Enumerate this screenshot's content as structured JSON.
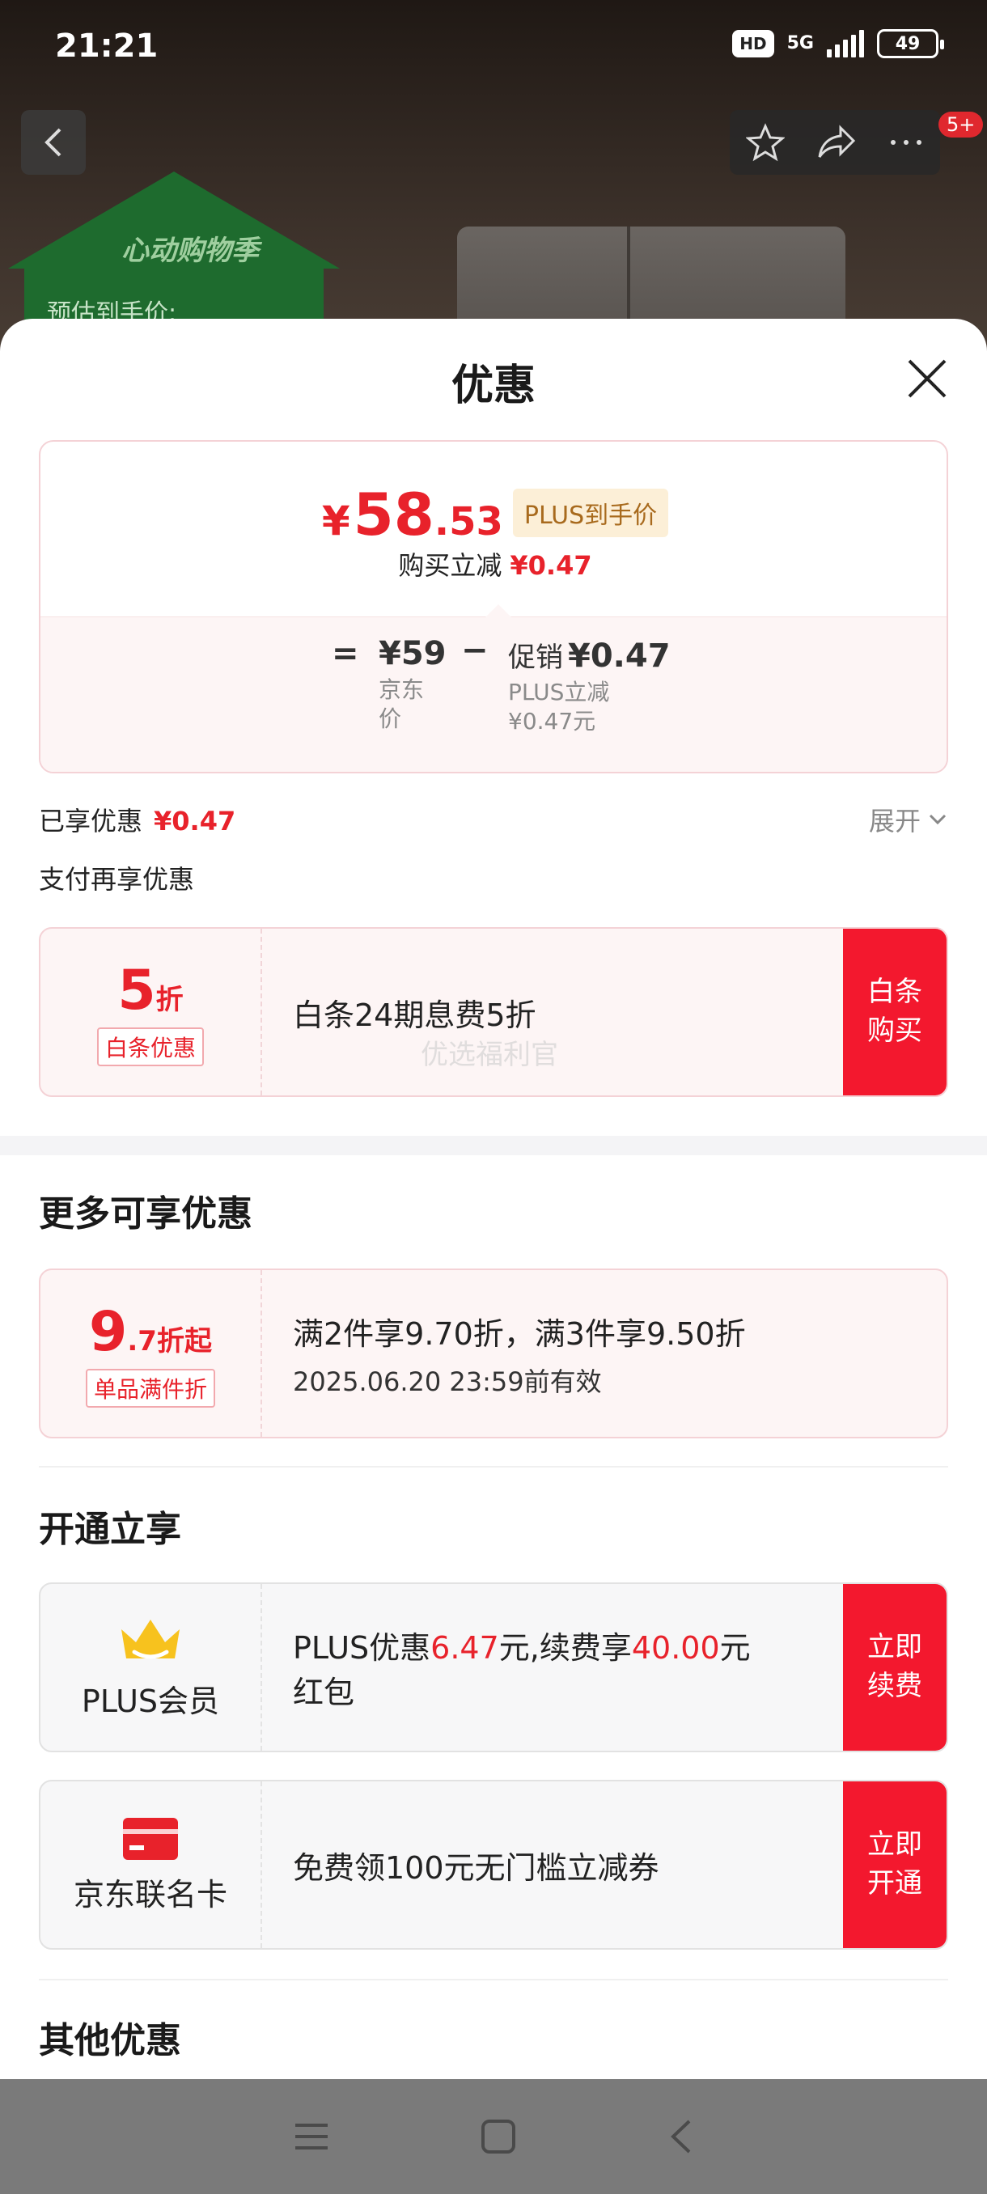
{
  "status_bar": {
    "time": "21:21",
    "hd": "HD",
    "network": "5G",
    "battery": "49"
  },
  "header": {
    "cart_badge": "5+"
  },
  "banner": {
    "title": "心动购物季",
    "subtitle": "预估到手价:"
  },
  "sheet": {
    "title": "优惠"
  },
  "price_card": {
    "currency": "¥",
    "price_int": "58",
    "price_dec": ".53",
    "plus_tag": "PLUS到手价",
    "instant_label": "购买立减",
    "instant_value": "¥0.47",
    "eq": "=",
    "jd_price": "¥59",
    "jd_price_label_1": "京东",
    "jd_price_label_2": "价",
    "minus": "−",
    "promo_label": "促销",
    "promo_value": "¥0.47",
    "promo_desc_1": "PLUS立减",
    "promo_desc_2": "¥0.47元"
  },
  "enjoyed": {
    "label": "已享优惠",
    "value": "¥0.47",
    "expand": "展开"
  },
  "pay_again": {
    "label": "支付再享优惠"
  },
  "baitiao_offer": {
    "discount_num": "5",
    "discount_unit": "折",
    "tag": "白条优惠",
    "text": "白条24期息费5折",
    "watermark": "优选福利官",
    "button": "白条购买"
  },
  "more_section": {
    "title": "更多可享优惠"
  },
  "multi_offer": {
    "discount_num": "9",
    "discount_unit": ".7折起",
    "tag": "单品满件折",
    "text": "满2件享9.70折，满3件享9.50折",
    "validity": "2025.06.20 23:59前有效"
  },
  "open_section": {
    "title": "开通立享"
  },
  "plus_offer": {
    "label": "PLUS会员",
    "text_a": "PLUS优惠",
    "amount_a": "6.47",
    "text_b": "元,续费享",
    "amount_b": "40.00",
    "text_c": "元",
    "text_d": "红包",
    "button": "立即续费"
  },
  "card_offer": {
    "label": "京东联名卡",
    "text": "免费领100元无门槛立减券",
    "button": "立即开通"
  },
  "other_section": {
    "title": "其他优惠"
  },
  "colors": {
    "accent_red": "#e8222b",
    "button_red": "#f3182e",
    "plus_gold": "#a86a1d"
  }
}
